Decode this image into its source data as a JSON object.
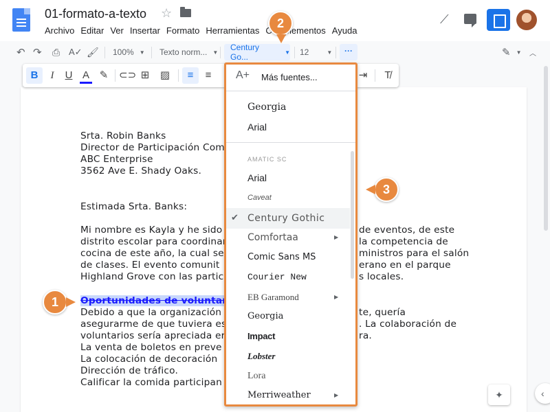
{
  "header": {
    "title": "01-formato-a-texto",
    "menu": [
      "Archivo",
      "Editar",
      "Ver",
      "Insertar",
      "Formato",
      "Herramientas",
      "Complementos",
      "Ayuda"
    ]
  },
  "toolbar": {
    "zoom": "100%",
    "style": "Texto norm...",
    "font": "Century Go...",
    "size": "12",
    "more": "···"
  },
  "letter": {
    "lines_address": [
      "Srta. Robin Banks",
      "Director de Participación Com",
      "ABC Enterprise",
      "3562 Ave E. Shady Oaks."
    ],
    "greeting": "Estimada Srta. Banks:",
    "para1": [
      [
        "Mi nombre es Kayla y he sido s",
        "de eventos, de este"
      ],
      [
        "distrito escolar para coordinar",
        "la competencia de"
      ],
      [
        "cocina de este año, la cual se",
        "ministros para el salón"
      ],
      [
        "de clases. El evento comunit",
        "erano en el parque"
      ],
      [
        "Highland Grove con las partic",
        "s locales."
      ]
    ],
    "heading": "Oportunidades de voluntariad",
    "para2": [
      [
        "Debido a que la organización",
        "te, quería"
      ],
      [
        "asegurarme de que tuviera es",
        ". La colaboración de"
      ],
      [
        "voluntarios sería apreciada er",
        ""
      ],
      [
        "La venta de boletos en preve",
        ""
      ],
      [
        "La colocación de decoración",
        "ra."
      ],
      [
        "Dirección de tráfico.",
        ""
      ],
      [
        "Calificar la comida participan",
        ""
      ]
    ]
  },
  "font_menu": {
    "more_fonts": "Más fuentes...",
    "recent": [
      "Georgia",
      "Arial"
    ],
    "fonts": [
      {
        "name": "AMATIC SC",
        "submenu": false,
        "selected": false
      },
      {
        "name": "Arial",
        "submenu": false,
        "selected": false
      },
      {
        "name": "Caveat",
        "submenu": false,
        "selected": false
      },
      {
        "name": "Century Gothic",
        "submenu": false,
        "selected": true
      },
      {
        "name": "Comfortaa",
        "submenu": true,
        "selected": false
      },
      {
        "name": "Comic Sans MS",
        "submenu": false,
        "selected": false
      },
      {
        "name": "Courier New",
        "submenu": false,
        "selected": false
      },
      {
        "name": "EB Garamond",
        "submenu": true,
        "selected": false
      },
      {
        "name": "Georgia",
        "submenu": false,
        "selected": false
      },
      {
        "name": "Impact",
        "submenu": false,
        "selected": false
      },
      {
        "name": "Lobster",
        "submenu": false,
        "selected": false
      },
      {
        "name": "Lora",
        "submenu": false,
        "selected": false
      },
      {
        "name": "Merriweather",
        "submenu": true,
        "selected": false
      }
    ]
  },
  "callouts": [
    "1",
    "2",
    "3"
  ],
  "colors": {
    "accent": "#1a73e8",
    "callout": "#e8893f",
    "strike": "#1a1aff"
  }
}
